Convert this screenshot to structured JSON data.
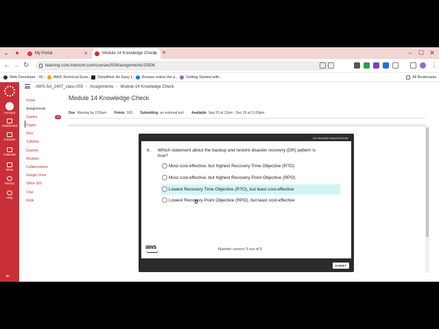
{
  "browser": {
    "tabs": [
      {
        "title": "My Portal"
      },
      {
        "title": "Module 14 Knowledge Check"
      }
    ],
    "url": "learning-core.theroom.com/courses/509/assignments/15506",
    "bookmarks": [
      {
        "label": "Web Developer - W..."
      },
      {
        "label": "AWS Technical Esse..."
      },
      {
        "label": "Simplified: An Easy t..."
      },
      {
        "label": "Browse online the p..."
      },
      {
        "label": "Getting Started with..."
      }
    ],
    "all_bookmarks": "All Bookmarks"
  },
  "global_nav": {
    "items": [
      {
        "label": "Account"
      },
      {
        "label": "Dashboard"
      },
      {
        "label": "Courses"
      },
      {
        "label": "Calendar"
      },
      {
        "label": "Inbox"
      },
      {
        "label": "History"
      },
      {
        "label": "Help"
      }
    ]
  },
  "breadcrumb": {
    "course": "AWS-SA_2407_class-003",
    "section": "Assignments",
    "page": "Module 14 Knowledge Check"
  },
  "course_nav": {
    "items": [
      {
        "label": "Home"
      },
      {
        "label": "Assignments"
      },
      {
        "label": "Grades"
      },
      {
        "label": "Pages"
      },
      {
        "label": "Files"
      },
      {
        "label": "Syllabus"
      },
      {
        "label": "Quizzes"
      },
      {
        "label": "Modules"
      },
      {
        "label": "Collaborations"
      },
      {
        "label": "Google Drive"
      },
      {
        "label": "Office 365"
      },
      {
        "label": "Chat"
      },
      {
        "label": "Kritik"
      }
    ],
    "grades_badge": "10"
  },
  "assignment": {
    "title": "Module 14 Knowledge Check",
    "due_label": "Due",
    "due_value": "Monday by 2:59am",
    "points_label": "Points",
    "points_value": "100",
    "submitting_label": "Submitting",
    "submitting_value": "an external tool",
    "available_label": "Available",
    "available_value": "Sep 23 at 12am - Dec 29 at 11:59pm"
  },
  "quiz": {
    "keyboard_nav": "KEYBOARD NAVIGATION",
    "question_number": "6.",
    "question_text": "Which statement about the backup and restore disaster recovery (DR) pattern is true?",
    "options": [
      {
        "label": "Most cost-effective, but highest Recovery Time Objective (RTO)"
      },
      {
        "label": "Most cost-effective, but highest Recovery Point Objective (RPO)"
      },
      {
        "label": "Lowest Recovery Time Objective (RTO), but least cost-effective"
      },
      {
        "label": "Lowest Recovery Point Objective (RPO), but least cost-effective"
      }
    ],
    "brand": "aws",
    "count_text": "Number correct: 5 out of 5",
    "submit_label": "SUBMIT"
  },
  "colors": {
    "brand_red": "#c92f36",
    "highlight": "#d3f4f4",
    "modal_dark": "#2b2b2b"
  }
}
